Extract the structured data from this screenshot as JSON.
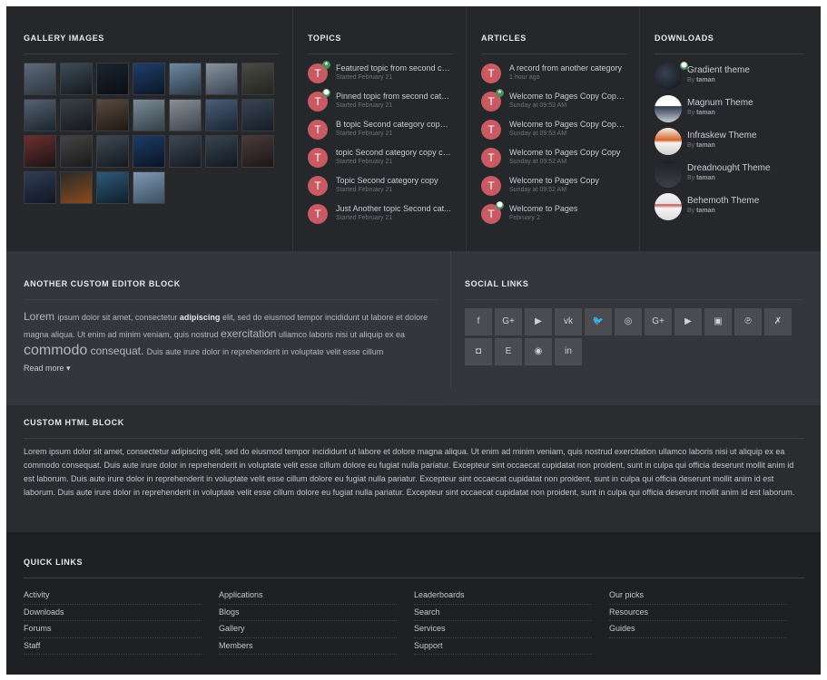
{
  "gallery": {
    "title": "Gallery Images",
    "thumb_count": 25
  },
  "topics": {
    "title": "Topics",
    "items": [
      {
        "title": "Featured topic from second ca...",
        "sub": "Started February 21",
        "badge": "star"
      },
      {
        "title": "Pinned topic from second cate...",
        "sub": "Started February 21",
        "badge": "pin"
      },
      {
        "title": "B topic Second category copy ...",
        "sub": "Started February 21",
        "badge": ""
      },
      {
        "title": "topic Second category copy co...",
        "sub": "Started February 21",
        "badge": ""
      },
      {
        "title": "Topic Second category copy",
        "sub": "Started February 21",
        "badge": ""
      },
      {
        "title": "Just Another topic Second cat...",
        "sub": "Started February 21",
        "badge": ""
      }
    ]
  },
  "articles": {
    "title": "Articles",
    "items": [
      {
        "title": "A record from another category",
        "sub": "1 hour ago",
        "badge": ""
      },
      {
        "title": "Welcome to Pages Copy Copy ...",
        "sub": "Sunday at 09:53 AM",
        "badge": "star"
      },
      {
        "title": "Welcome to Pages Copy Copy ...",
        "sub": "Sunday at 09:53 AM",
        "badge": ""
      },
      {
        "title": "Welcome to Pages Copy Copy",
        "sub": "Sunday at 09:52 AM",
        "badge": ""
      },
      {
        "title": "Welcome to Pages Copy",
        "sub": "Sunday at 09:52 AM",
        "badge": ""
      },
      {
        "title": "Welcome to Pages",
        "sub": "February 2",
        "badge": "pin"
      }
    ]
  },
  "downloads": {
    "title": "Downloads",
    "by": "By",
    "items": [
      {
        "title": "Gradient theme",
        "author": "taman",
        "badge": "pin"
      },
      {
        "title": "Magnum Theme",
        "author": "taman",
        "badge": ""
      },
      {
        "title": "Infraskew Theme",
        "author": "taman",
        "badge": ""
      },
      {
        "title": "Dreadnought Theme",
        "author": "taman",
        "badge": ""
      },
      {
        "title": "Behemoth Theme",
        "author": "taman",
        "badge": ""
      }
    ]
  },
  "avatar_letter": "T",
  "editor": {
    "title": "Another custom editor block",
    "read_more": "Read more ▾",
    "words": [
      {
        "t": "Lorem ",
        "s": "big"
      },
      {
        "t": "ipsum dolor sit amet, consectetur ",
        "s": ""
      },
      {
        "t": "adipiscing",
        "s": "bold"
      },
      {
        "t": " elit, sed do eiusmod tempor incididunt ut labore et dolore magna aliqua. Ut enim ad minim veniam, quis nostrud ",
        "s": ""
      },
      {
        "t": "exercitation",
        "s": "big"
      },
      {
        "t": " ullamco laboris nisi ut aliquip ex ea ",
        "s": ""
      },
      {
        "t": "commodo",
        "s": "huge"
      },
      {
        "t": " consequat. ",
        "s": "big"
      },
      {
        "t": "Duis aute irure dolor in reprehenderit in voluptate velit esse cillum",
        "s": ""
      }
    ]
  },
  "social": {
    "title": "Social Links",
    "icons": [
      {
        "name": "facebook-icon",
        "glyph": "f"
      },
      {
        "name": "google-plus-icon",
        "glyph": "G+"
      },
      {
        "name": "youtube-icon",
        "glyph": "▶"
      },
      {
        "name": "vk-icon",
        "glyph": "vk"
      },
      {
        "name": "twitter-icon",
        "glyph": "🐦"
      },
      {
        "name": "instagram-icon",
        "glyph": "◎"
      },
      {
        "name": "google-plus-icon",
        "glyph": "G+"
      },
      {
        "name": "youtube-icon",
        "glyph": "▶"
      },
      {
        "name": "twitch-icon",
        "glyph": "▣"
      },
      {
        "name": "pinterest-icon",
        "glyph": "℗"
      },
      {
        "name": "xing-icon",
        "glyph": "✗"
      },
      {
        "name": "discord-icon",
        "glyph": "◘"
      },
      {
        "name": "etsy-icon",
        "glyph": "E"
      },
      {
        "name": "github-icon",
        "glyph": "◉"
      },
      {
        "name": "linkedin-icon",
        "glyph": "in"
      }
    ]
  },
  "custom_html": {
    "title": "Custom HTML block",
    "text": "Lorem ipsum dolor sit amet, consectetur adipiscing elit, sed do eiusmod tempor incididunt ut labore et dolore magna aliqua. Ut enim ad minim veniam, quis nostrud exercitation ullamco laboris nisi ut aliquip ex ea commodo consequat. Duis aute irure dolor in reprehenderit in voluptate velit esse cillum dolore eu fugiat nulla pariatur. Excepteur sint occaecat cupidatat non proident, sunt in culpa qui officia deserunt mollit anim id est laborum. Duis aute irure dolor in reprehenderit in voluptate velit esse cillum dolore eu fugiat nulla pariatur. Excepteur sint occaecat cupidatat non proident, sunt in culpa qui officia deserunt mollit anim id est laborum. Duis aute irure dolor in reprehenderit in voluptate velit esse cillum dolore eu fugiat nulla pariatur. Excepteur sint occaecat cupidatat non proident, sunt in culpa qui officia deserunt mollit anim id est laborum."
  },
  "quick_links": {
    "title": "Quick Links",
    "columns": [
      [
        "Activity",
        "Downloads",
        "Forums",
        "Staff"
      ],
      [
        "Applications",
        "Blogs",
        "Gallery",
        "Members"
      ],
      [
        "Leaderboards",
        "Search",
        "Services",
        "Support"
      ],
      [
        "Our picks",
        "Resources",
        "Guides"
      ]
    ]
  },
  "colors": {
    "avatar": "#c85a64",
    "badge": "#4a8f5a",
    "background": "#2b2c30"
  }
}
